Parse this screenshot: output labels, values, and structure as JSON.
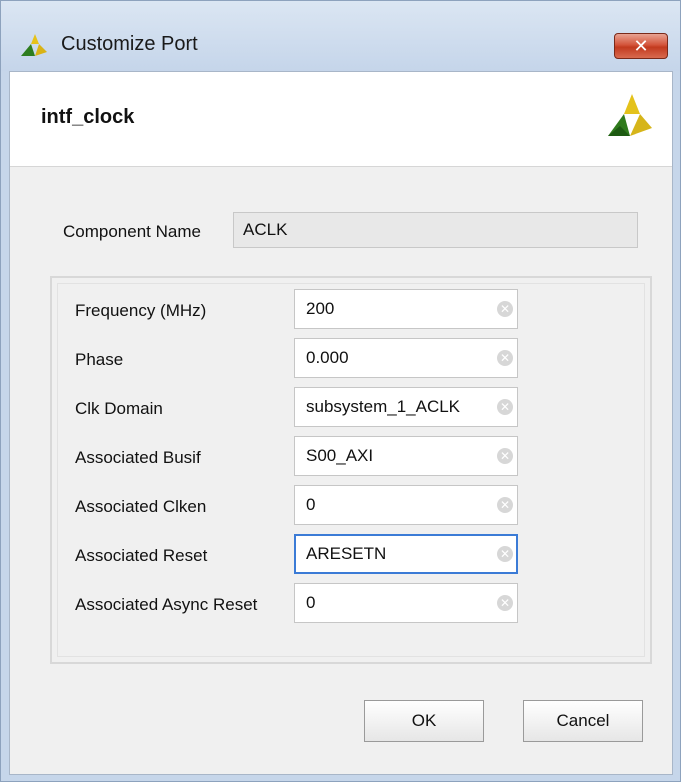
{
  "window": {
    "title": "Customize Port",
    "close_label": "✕",
    "title_logo_icon": "xilinx-logo-icon"
  },
  "header": {
    "title": "intf_clock",
    "logo_icon": "xilinx-logo-icon"
  },
  "component": {
    "label": "Component Name",
    "value": "ACLK"
  },
  "fields": [
    {
      "label": "Frequency (MHz)",
      "value": "200"
    },
    {
      "label": "Phase",
      "value": "0.000"
    },
    {
      "label": "Clk Domain",
      "value": "subsystem_1_ACLK"
    },
    {
      "label": "Associated Busif",
      "value": "S00_AXI"
    },
    {
      "label": "Associated Clken",
      "value": "0"
    },
    {
      "label": "Associated Reset",
      "value": "ARESETN",
      "focused": true
    },
    {
      "label": "Associated Async Reset",
      "value": "0"
    }
  ],
  "clear_icon_glyph": "✕",
  "buttons": {
    "ok_label": "OK",
    "cancel_label": "Cancel"
  },
  "colors": {
    "focus_border": "#3b7bd6",
    "close_button": "#c94a2e",
    "logo_dark": "#1f6b1f",
    "logo_light": "#e8c81e"
  }
}
